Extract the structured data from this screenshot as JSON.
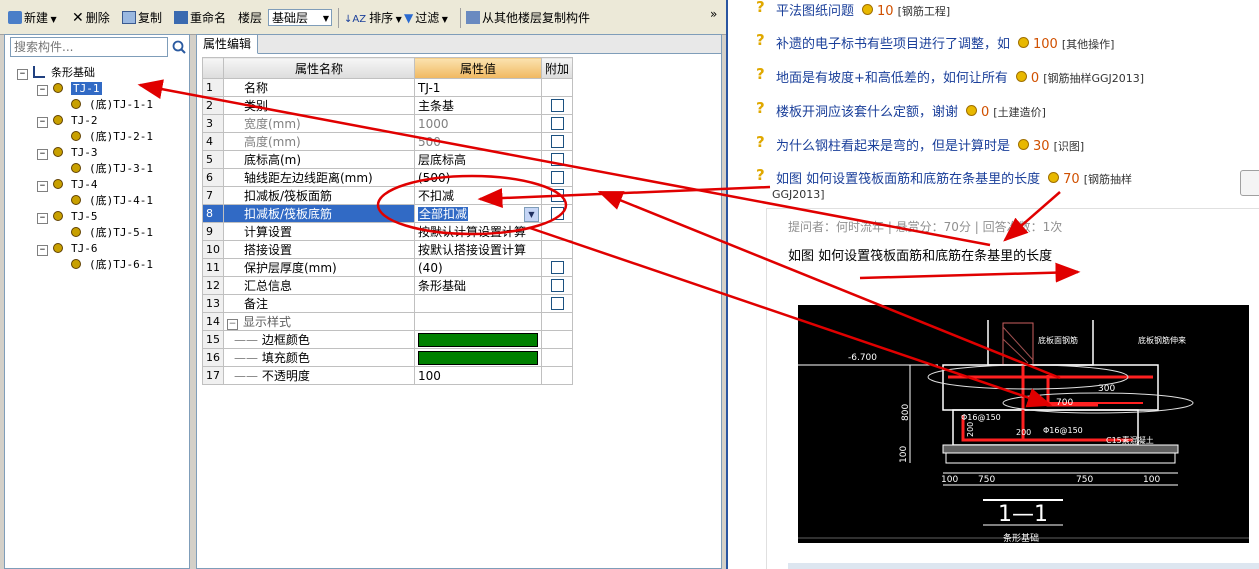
{
  "toolbar": {
    "new_label": "新建",
    "delete_label": "删除",
    "copy_label": "复制",
    "rename_label": "重命名",
    "floor_label": "楼层",
    "floor_value": "基础层",
    "sort_label": "排序",
    "filter_label": "过滤",
    "copy_from_floor_label": "从其他楼层复制构件",
    "overflow": "»"
  },
  "tree": {
    "search_placeholder": "搜索构件...",
    "root": "条形基础",
    "items": [
      {
        "label": "TJ-1",
        "child": "(底)TJ-1-1",
        "selected": true
      },
      {
        "label": "TJ-2",
        "child": "(底)TJ-2-1"
      },
      {
        "label": "TJ-3",
        "child": "(底)TJ-3-1"
      },
      {
        "label": "TJ-4",
        "child": "(底)TJ-4-1"
      },
      {
        "label": "TJ-5",
        "child": "(底)TJ-5-1"
      },
      {
        "label": "TJ-6",
        "child": "(底)TJ-6-1"
      }
    ]
  },
  "props": {
    "tab": "属性编辑",
    "headers": [
      "属性名称",
      "属性值",
      "附加"
    ],
    "rows": [
      {
        "n": "1",
        "name": "名称",
        "value": "TJ-1"
      },
      {
        "n": "2",
        "name": "类别",
        "value": "主条基",
        "cb": true
      },
      {
        "n": "3",
        "name": "宽度(mm)",
        "value": "1000",
        "cb": true,
        "disabled": true
      },
      {
        "n": "4",
        "name": "高度(mm)",
        "value": "500",
        "cb": true,
        "disabled": true
      },
      {
        "n": "5",
        "name": "底标高(m)",
        "value": "层底标高",
        "cb": true
      },
      {
        "n": "6",
        "name": "轴线距左边线距离(mm)",
        "value": "(500)",
        "cb": true
      },
      {
        "n": "7",
        "name": "扣减板/筏板面筋",
        "value": "不扣减",
        "cb": true
      },
      {
        "n": "8",
        "name": "扣减板/筏板底筋",
        "value": "全部扣减",
        "cb": true,
        "highlight": true
      },
      {
        "n": "9",
        "name": "计算设置",
        "value": "按默认计算设置计算"
      },
      {
        "n": "10",
        "name": "搭接设置",
        "value": "按默认搭接设置计算"
      },
      {
        "n": "11",
        "name": "保护层厚度(mm)",
        "value": "(40)",
        "cb": true
      },
      {
        "n": "12",
        "name": "汇总信息",
        "value": "条形基础",
        "cb": true
      },
      {
        "n": "13",
        "name": "备注",
        "value": "",
        "cb": true
      },
      {
        "n": "14",
        "name": "显示样式",
        "value": "",
        "group": true
      },
      {
        "n": "15",
        "name": "边框颜色",
        "value": "",
        "swatch": true
      },
      {
        "n": "16",
        "name": "填充颜色",
        "value": "",
        "swatch": true
      },
      {
        "n": "17",
        "name": "不透明度",
        "value": "100"
      }
    ],
    "swatch_color": "#008000"
  },
  "qa": {
    "questions": [
      {
        "title": "平法图纸问题",
        "score": "10",
        "cat": "[钢筋工程]"
      },
      {
        "title": "补遗的电子标书有些项目进行了调整，如",
        "score": "100",
        "cat": "[其他操作]"
      },
      {
        "title": "地面是有坡度+和高低差的，如何让所有",
        "score": "0",
        "cat": "[钢筋抽样GGJ2013]"
      },
      {
        "title": "楼板开洞应该套什么定额，谢谢",
        "score": "0",
        "cat": "[土建造价]"
      },
      {
        "title": "为什么钢柱看起来是弯的，但是计算时是",
        "score": "30",
        "cat": "[识图]"
      },
      {
        "title": "如图 如何设置筏板面筋和底筋在条基里的长度",
        "score": "70",
        "cat": "[钢筋抽样",
        "cat2": "GGJ2013]"
      }
    ],
    "meta": "提问者：何时流年 | 悬赏分：70分 | 回答次数：1次",
    "detail_title": "如图 如何设置筏板面筋和底筋在条基里的长度"
  },
  "cad": {
    "labels": {
      "elev": "-6.700",
      "top_label1": "底板面钢筋",
      "top_label2": "底板钢筋伸来",
      "dim800": "800",
      "dim100": "100",
      "dim300": "300",
      "dim700": "700",
      "bar1": "Φ16@150",
      "bar2": "Φ16@150",
      "dim200a": "200",
      "dim200b": "200",
      "concrete": "C15素混凝土",
      "d100a": "100",
      "d750a": "750",
      "d750b": "750",
      "d100b": "100",
      "section": "1—1",
      "caption": "条形基础"
    }
  },
  "colors": {
    "annotation": "#e00000",
    "selection": "#316ac5"
  }
}
